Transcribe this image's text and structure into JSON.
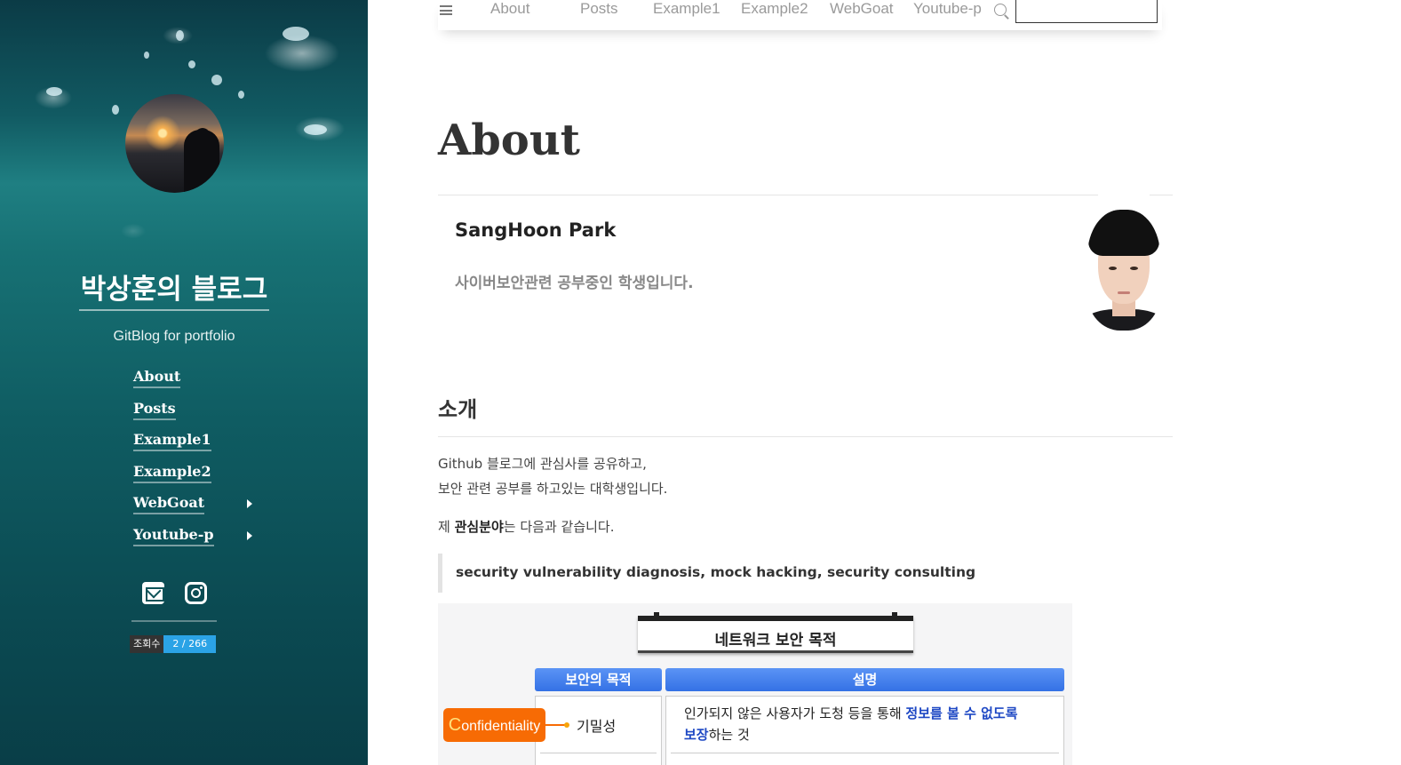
{
  "sidebar": {
    "title": "박상훈의 블로그",
    "subtitle": "GitBlog for portfolio",
    "nav": [
      {
        "label": "About",
        "has_submenu": false
      },
      {
        "label": "Posts",
        "has_submenu": false
      },
      {
        "label": "Example1",
        "has_submenu": false
      },
      {
        "label": "Example2",
        "has_submenu": false
      },
      {
        "label": "WebGoat",
        "has_submenu": true
      },
      {
        "label": "Youtube-p",
        "has_submenu": true
      }
    ],
    "social_icons": [
      "mail-icon",
      "instagram-icon"
    ],
    "counter": {
      "label": "조회수",
      "value": "2 / 266"
    }
  },
  "topnav": {
    "menu_icon": "hamburger-icon",
    "links": [
      "About",
      "Posts",
      "Example1",
      "Example2",
      "WebGoat",
      "Youtube-p"
    ],
    "search_icon": "search-icon",
    "search_value": ""
  },
  "main": {
    "page_title": "About",
    "author_name": "SangHoon Park",
    "author_intro": "사이버보안관련 공부중인 학생입니다.",
    "section_title": "소개",
    "para1_line1": "Github 블로그에 관심사를 공유하고,",
    "para1_line2": "보안 관련 공부를 하고있는 대학생입니다.",
    "para2_prefix": "제 ",
    "para2_bold": "관심분야",
    "para2_suffix": "는 다음과 같습니다.",
    "quote": "security vulnerability diagnosis, mock hacking, security consulting"
  },
  "diagram": {
    "title": "네트워크 보안 목적",
    "header_left": "보안의 목적",
    "header_right": "설명",
    "row1": {
      "badge_first": "C",
      "badge_rest": "onfidentiality",
      "korean": "기밀성",
      "desc_plain1": "인가되지 않은 사용자가 도청 등을 통해 ",
      "desc_hl1": "정보를 볼 수 없도록",
      "desc_hl2": "보장",
      "desc_plain2": "하는 것"
    }
  },
  "colors": {
    "accent_blue": "#2ba3e6",
    "badge_orange": "#f76b04",
    "header_blue": "#3471e5",
    "highlight_blue": "#1e48c4"
  }
}
